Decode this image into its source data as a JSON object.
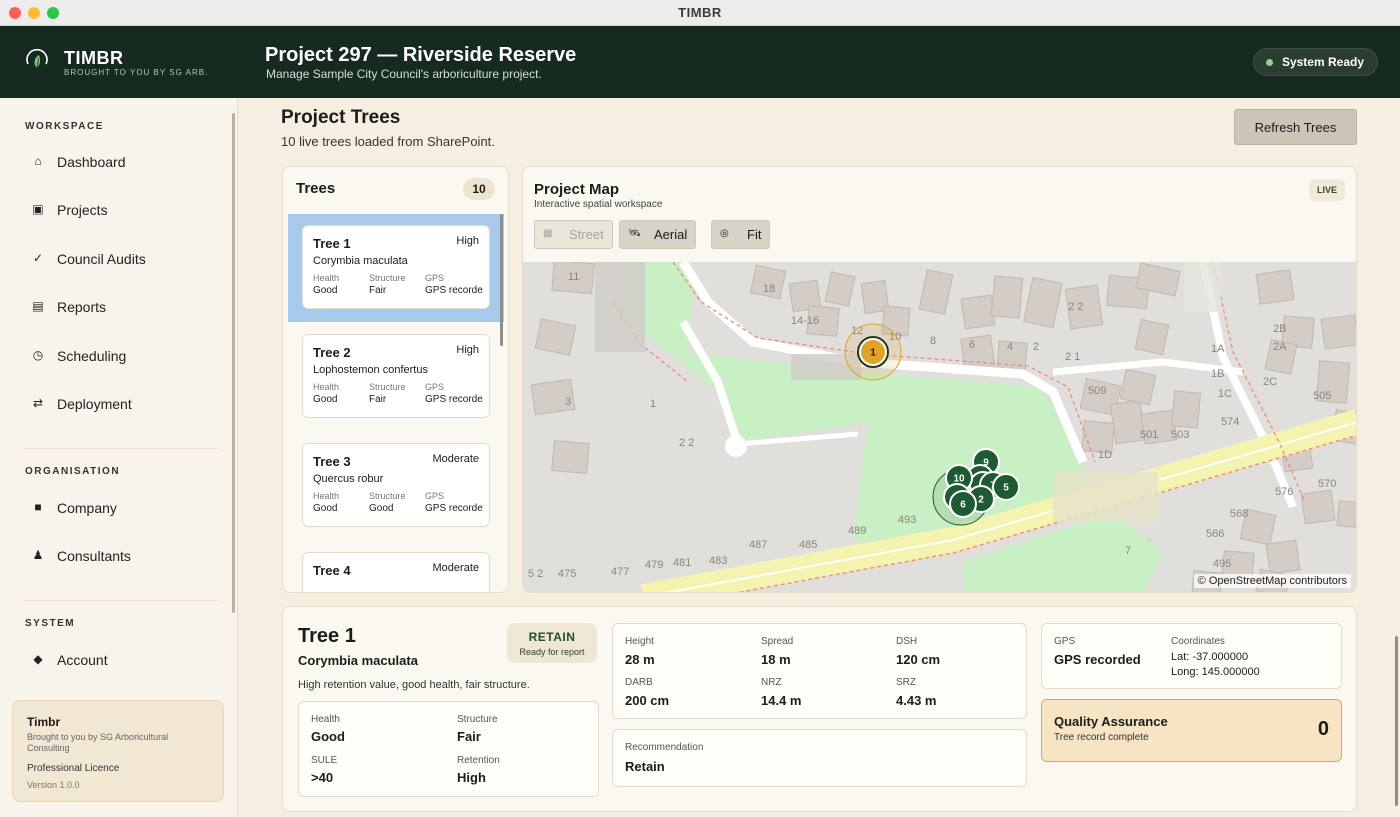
{
  "window": {
    "title": "TIMBR"
  },
  "brand": {
    "name": "TIMBR",
    "tagline": "BROUGHT TO YOU BY SG ARB."
  },
  "header": {
    "project_title": "Project 297 — Riverside Reserve",
    "project_subtitle": "Manage Sample City Council's arboriculture project.",
    "status": "System Ready"
  },
  "sidebar": {
    "sections": [
      {
        "title": "WORKSPACE",
        "items": [
          {
            "label": "Dashboard",
            "icon": "home-icon"
          },
          {
            "label": "Projects",
            "icon": "projects-icon"
          },
          {
            "label": "Council Audits",
            "icon": "check-icon"
          },
          {
            "label": "Reports",
            "icon": "reports-icon"
          },
          {
            "label": "Scheduling",
            "icon": "clock-icon"
          },
          {
            "label": "Deployment",
            "icon": "swap-icon"
          }
        ]
      },
      {
        "title": "ORGANISATION",
        "items": [
          {
            "label": "Company",
            "icon": "company-icon"
          },
          {
            "label": "Consultants",
            "icon": "person-icon"
          }
        ]
      },
      {
        "title": "SYSTEM",
        "items": [
          {
            "label": "Account",
            "icon": "diamond-icon"
          }
        ]
      }
    ],
    "card": {
      "title": "Timbr",
      "subtitle": "Brought to you by SG Arboricultural Consulting",
      "licence": "Professional Licence",
      "version": "Version 1.0.0"
    }
  },
  "main": {
    "title": "Project Trees",
    "subtitle": "10 live trees loaded from SharePoint.",
    "refresh_label": "Refresh Trees"
  },
  "trees_panel": {
    "title": "Trees",
    "count": "10",
    "field_labels": {
      "health": "Health",
      "structure": "Structure",
      "gps": "GPS"
    },
    "items": [
      {
        "name": "Tree 1",
        "priority": "High",
        "species": "Corymbia maculata",
        "health": "Good",
        "structure": "Fair",
        "gps": "GPS recorded",
        "selected": true
      },
      {
        "name": "Tree 2",
        "priority": "High",
        "species": "Lophostemon confertus",
        "health": "Good",
        "structure": "Fair",
        "gps": "GPS recorded"
      },
      {
        "name": "Tree 3",
        "priority": "Moderate",
        "species": "Quercus robur",
        "health": "Good",
        "structure": "Good",
        "gps": "GPS recorded"
      },
      {
        "name": "Tree 4",
        "priority": "Moderate",
        "species": "",
        "health": "",
        "structure": "",
        "gps": ""
      }
    ]
  },
  "map": {
    "title": "Project Map",
    "subtitle": "Interactive spatial workspace",
    "live_badge": "LIVE",
    "buttons": {
      "street": "Street",
      "aerial": "Aerial",
      "fit": "Fit"
    },
    "attribution": "© OpenStreetMap contributors",
    "colors": {
      "marker_active": "#e0a32a",
      "marker": "#1f5a33",
      "park": "#c9efc4",
      "road": "#f5f3b0"
    },
    "house_numbers": [
      "11",
      "18",
      "14-16",
      "12",
      "10",
      "8",
      "6",
      "4",
      "2",
      "2 2",
      "2 1",
      "1A",
      "1B",
      "1C",
      "2C",
      "2B",
      "2A",
      "509",
      "505",
      "503",
      "501",
      "1D",
      "574",
      "576",
      "570",
      "568",
      "566",
      "7",
      "495",
      "493",
      "489",
      "487",
      "485",
      "483",
      "481",
      "479",
      "477",
      "475",
      "5 2",
      "3",
      "1",
      "2 2"
    ],
    "markers": [
      {
        "label": "1",
        "active": true
      },
      {
        "label": "9"
      },
      {
        "label": "10"
      },
      {
        "label": "3"
      },
      {
        "label": "4"
      },
      {
        "label": "7"
      },
      {
        "label": "5"
      },
      {
        "label": "8"
      },
      {
        "label": "2"
      },
      {
        "label": "6"
      }
    ]
  },
  "detail": {
    "name": "Tree 1",
    "species": "Corymbia maculata",
    "description": "High retention value, good health, fair structure.",
    "badge": {
      "main": "RETAIN",
      "sub": "Ready for report"
    },
    "assessment": [
      {
        "label": "Health",
        "value": "Good"
      },
      {
        "label": "Structure",
        "value": "Fair"
      },
      {
        "label": "SULE",
        "value": ">40"
      },
      {
        "label": "Retention",
        "value": "High"
      }
    ],
    "measurements": [
      {
        "label": "Height",
        "value": "28 m"
      },
      {
        "label": "Spread",
        "value": "18 m"
      },
      {
        "label": "DSH",
        "value": "120 cm"
      },
      {
        "label": "DARB",
        "value": "200 cm"
      },
      {
        "label": "NRZ",
        "value": "14.4 m"
      },
      {
        "label": "SRZ",
        "value": "4.43 m"
      }
    ],
    "recommendation": {
      "label": "Recommendation",
      "value": "Retain"
    },
    "gps": {
      "label": "GPS",
      "value": "GPS recorded"
    },
    "coordinates": {
      "label": "Coordinates",
      "lat": "Lat: -37.000000",
      "long": "Long: 145.000000"
    },
    "qa": {
      "title": "Quality Assurance",
      "subtitle": "Tree record complete",
      "count": "0"
    }
  }
}
